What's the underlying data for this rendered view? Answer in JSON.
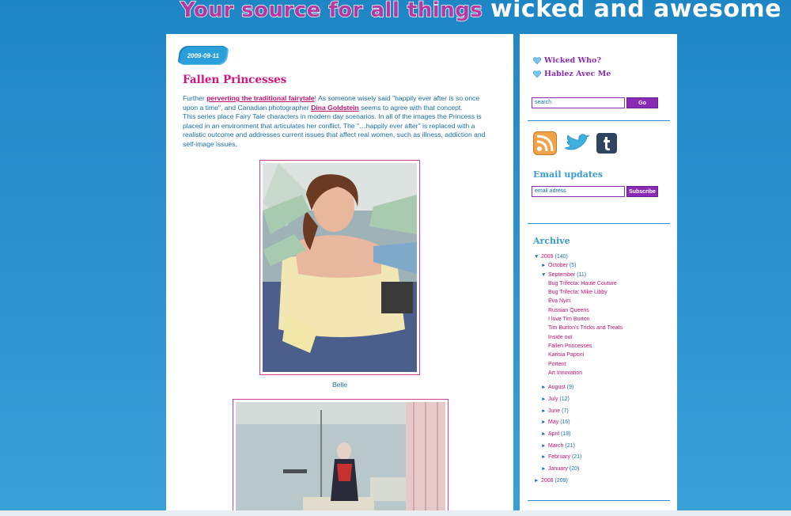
{
  "header": {
    "banner_part1": "Your source for all things",
    "banner_part2": "wicked and awesome"
  },
  "post": {
    "date": "2009-09-11",
    "title": "Fallen Princesses",
    "p1_before": "Further ",
    "p1_link1": "perverting the traditional fairytale",
    "p1_mid": "! As someone wisely said \"happily ever after is so once upon a time\", and Canadian photographer ",
    "p1_link2": "Dina Goldstein",
    "p1_after": " seems to agree with that concept.",
    "p2": "This series place Fairy Tale characters in modern day scenarios. In all of the images the Princess is placed in an environment that articulates her conflict. The \"…happily ever after\" is replaced with a realistic outcome and addresses current issues that affect real women, such as illness, addiction and self-image issues.",
    "caption1": "Belle"
  },
  "sidebar": {
    "link1": "Wicked Who?",
    "link2": "Hablez Avec Me",
    "search_value": "search",
    "search_button": "Go",
    "email_heading": "Email updates",
    "email_value": "email adress",
    "email_button": "Subscribe",
    "archive_heading": "Archive",
    "archive": {
      "y2009": {
        "label": "2009",
        "count": "(140)"
      },
      "october": {
        "label": "October",
        "count": "(5)"
      },
      "september": {
        "label": "September",
        "count": "(11)"
      },
      "posts": [
        "Bug Trifecta: Haute Couture",
        "Bug Trifecta: Mike Libby",
        "Éva Nyiri",
        "Russian Queens",
        "I love Tim Burton",
        "Tim Burton's Tricks and Treats",
        "Inside out",
        "Fallen Princesses",
        "Karisia Paponi",
        "Portent",
        "Art Innovation"
      ],
      "months": [
        {
          "label": "August",
          "count": "(9)"
        },
        {
          "label": "July",
          "count": "(12)"
        },
        {
          "label": "June",
          "count": "(7)"
        },
        {
          "label": "May",
          "count": "(16)"
        },
        {
          "label": "April",
          "count": "(18)"
        },
        {
          "label": "March",
          "count": "(21)"
        },
        {
          "label": "February",
          "count": "(21)"
        },
        {
          "label": "January",
          "count": "(20)"
        }
      ],
      "y2008": {
        "label": "2008",
        "count": "(209)"
      }
    }
  },
  "colors": {
    "accent_pink": "#d4147c",
    "accent_purple": "#8a2bb8",
    "link_blue": "#1a6ea8",
    "page_blue": "#2a8fcd"
  },
  "icons": [
    "heart-icon",
    "rss-icon",
    "twitter-bird-icon",
    "tumblr-icon"
  ]
}
